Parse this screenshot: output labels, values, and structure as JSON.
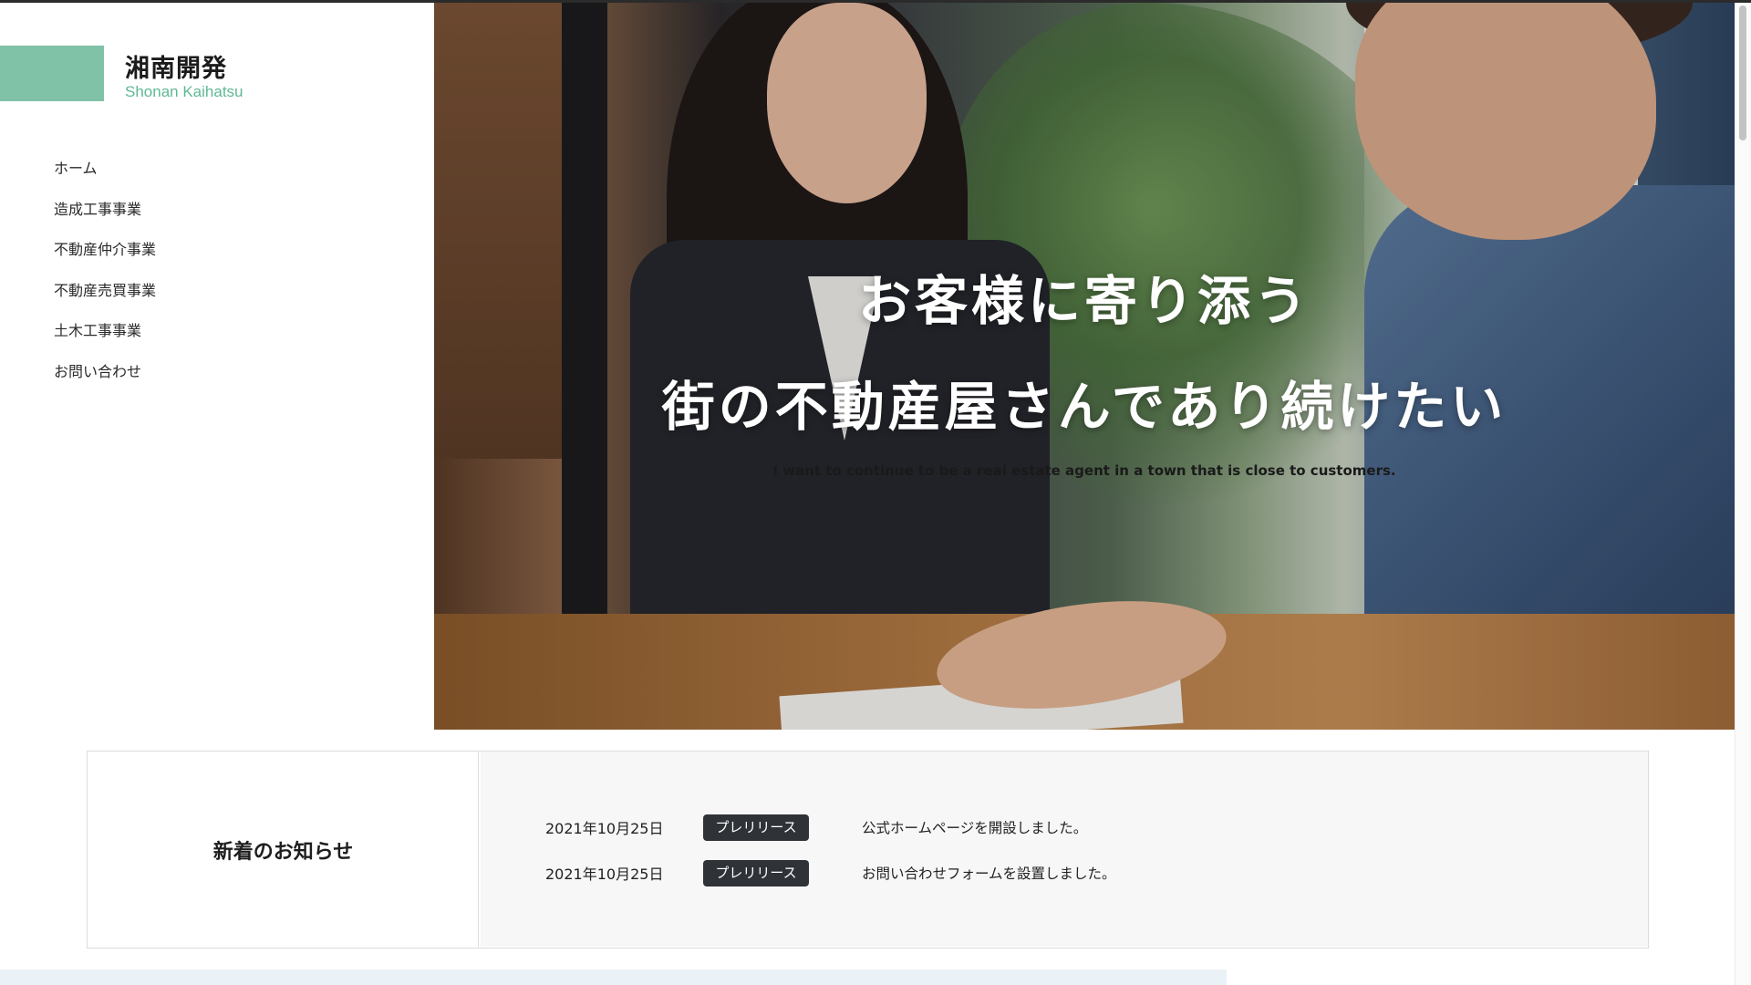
{
  "site": {
    "title": "湘南開発",
    "subtitle": "Shonan Kaihatsu",
    "accent": "#7fc2a7"
  },
  "nav": {
    "items": [
      {
        "label": "ホーム"
      },
      {
        "label": "造成工事事業"
      },
      {
        "label": "不動産仲介事業"
      },
      {
        "label": "不動産売買事業"
      },
      {
        "label": "土木工事事業"
      },
      {
        "label": "お問い合わせ"
      }
    ]
  },
  "hero": {
    "line1": "お客様に寄り添う",
    "line2": "街の不動産屋さんであり続けたい",
    "sub": "I want to continue to be a real estate agent in a town that is close to customers."
  },
  "news": {
    "heading": "新着のお知らせ",
    "items": [
      {
        "date": "2021年10月25日",
        "tag": "プレリリース",
        "text": "公式ホームページを開設しました。"
      },
      {
        "date": "2021年10月25日",
        "tag": "プレリリース",
        "text": "お問い合わせフォームを設置しました。"
      }
    ]
  }
}
